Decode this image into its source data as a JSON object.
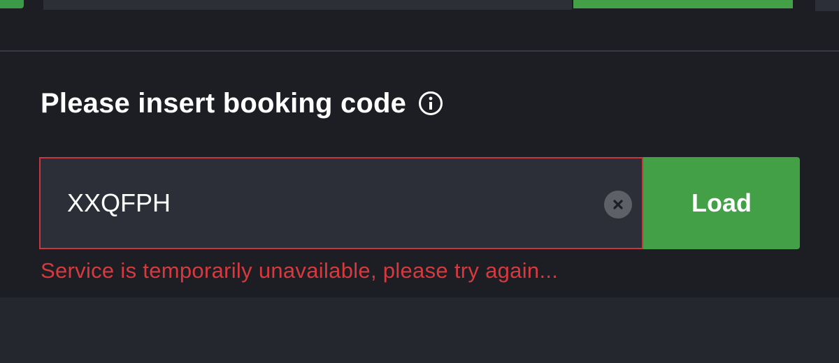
{
  "form": {
    "heading": "Please insert booking code",
    "input_value": "XXQFPH",
    "load_label": "Load",
    "error_message": "Service is temporarily unavailable, please try again..."
  },
  "icons": {
    "info": "info-icon",
    "clear": "clear-icon"
  },
  "colors": {
    "background": "#1c1e23",
    "field_background": "#2d2f38",
    "error": "#d63a3f",
    "accent_green": "#43a047",
    "text": "#ffffff"
  }
}
